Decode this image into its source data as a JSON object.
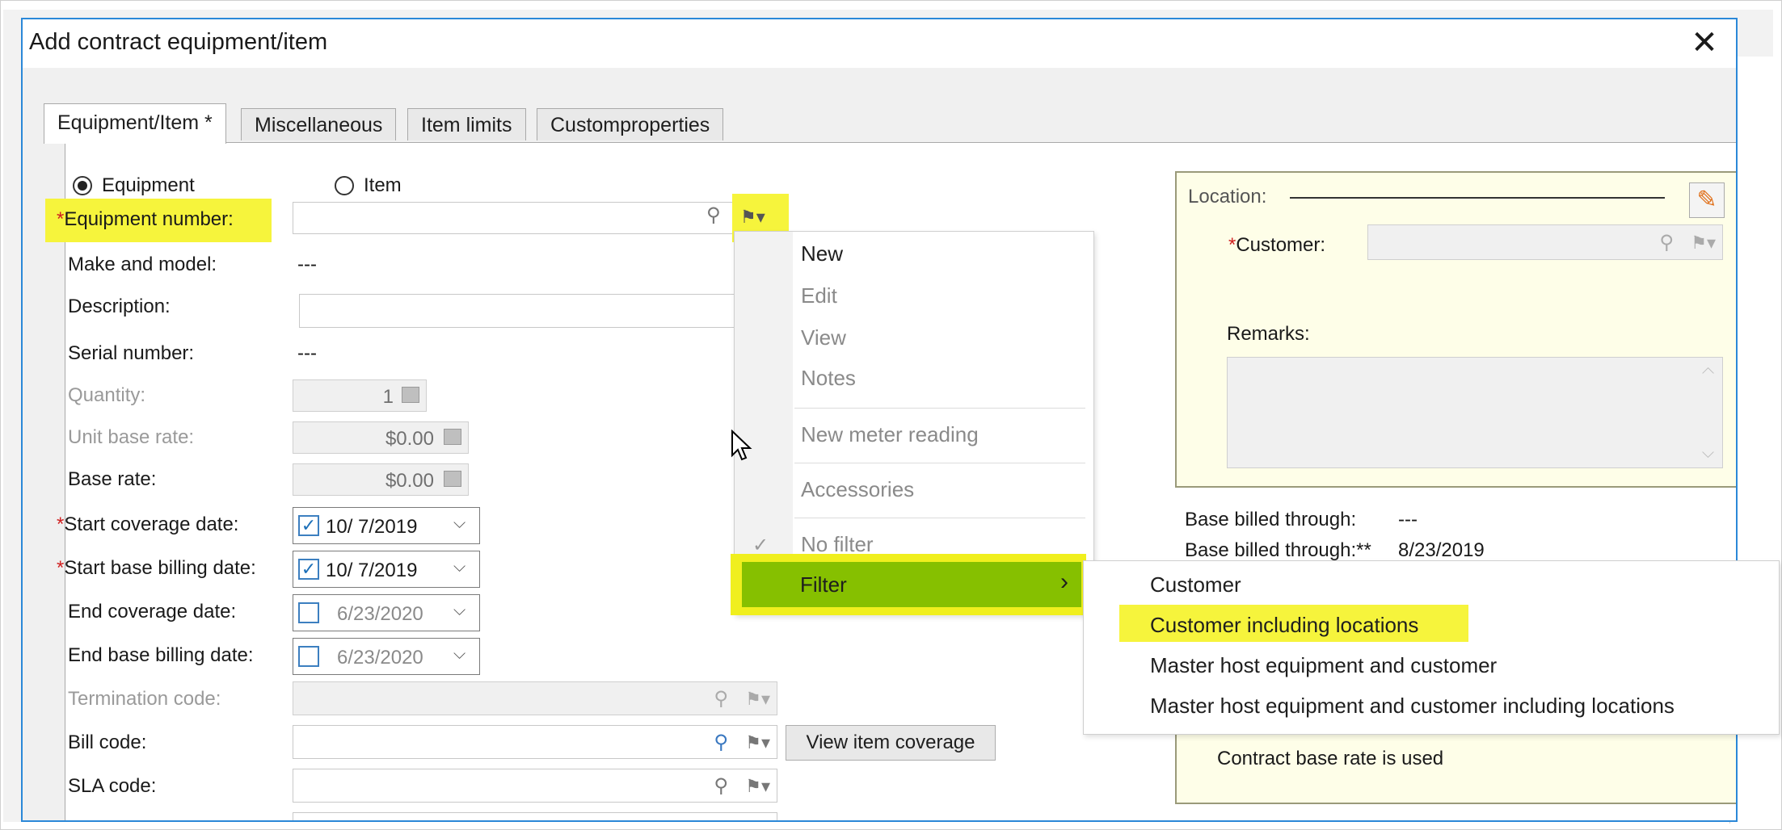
{
  "dialog": {
    "title": "Add contract equipment/item",
    "close_label": "✕"
  },
  "tabs": [
    {
      "label": "Equipment/Item *"
    },
    {
      "label": "Miscellaneous"
    },
    {
      "label": "Item limits"
    },
    {
      "label": "Customproperties"
    }
  ],
  "mode": {
    "equipment_label": "Equipment",
    "item_label": "Item",
    "selected": "Equipment"
  },
  "form": {
    "equipment_number": {
      "label": "Equipment number:",
      "value": ""
    },
    "make_model": {
      "label": "Make and model:",
      "value": "---"
    },
    "description": {
      "label": "Description:",
      "value": ""
    },
    "serial_number": {
      "label": "Serial number:",
      "value": "---"
    },
    "quantity": {
      "label": "Quantity:",
      "value": "1"
    },
    "unit_base_rate": {
      "label": "Unit base rate:",
      "value": "$0.00"
    },
    "base_rate": {
      "label": "Base rate:",
      "value": "$0.00"
    },
    "start_coverage_date": {
      "label": "Start coverage date:",
      "value": "10/  7/2019",
      "checked": true
    },
    "start_base_billing_date": {
      "label": "Start base billing date:",
      "value": "10/  7/2019",
      "checked": true
    },
    "end_coverage_date": {
      "label": "End coverage date:",
      "value": "6/23/2020",
      "checked": false
    },
    "end_base_billing_date": {
      "label": "End base billing date:",
      "value": "6/23/2020",
      "checked": false
    },
    "termination_code": {
      "label": "Termination code:",
      "value": ""
    },
    "bill_code": {
      "label": "Bill code:",
      "value": ""
    },
    "sla_code": {
      "label": "SLA code:",
      "value": ""
    },
    "required_mark": "*",
    "view_item_coverage_label": "View item coverage"
  },
  "location": {
    "title": "Location:",
    "customer_label": "Customer:",
    "customer_value": "",
    "remarks_label": "Remarks:",
    "remarks_value": ""
  },
  "billing": {
    "base_billed_through_label": "Base billed through:",
    "base_billed_through_value": "---",
    "base_billed_through2_label": "Base billed through:**",
    "base_billed_through2_value": "8/23/2019",
    "contract_note": "Contract base rate is used"
  },
  "context_menu": {
    "items": [
      "New",
      "Edit",
      "View",
      "Notes",
      "New meter reading",
      "Accessories",
      "No filter",
      "Filter"
    ]
  },
  "submenu": {
    "items": [
      "Customer",
      "Customer including locations",
      "Master host equipment and customer",
      "Master host equipment and customer including locations"
    ]
  },
  "icons": {
    "search": "⚲",
    "flag": "⚑▾",
    "chevron": "⌵",
    "check": "✓",
    "arrow": "›",
    "pencil": "✎"
  },
  "colors": {
    "accent_border": "#2b88d8",
    "highlight": "#f6f43c",
    "filter_active": "#86c000",
    "location_bg": "#fefee8"
  }
}
